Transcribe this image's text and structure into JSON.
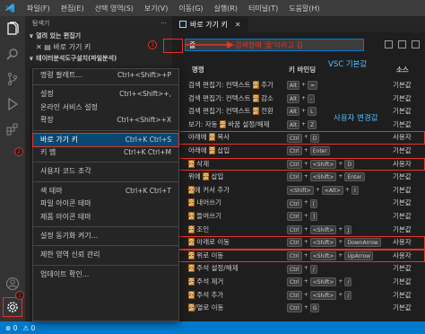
{
  "menubar": {
    "items": [
      "파일(F)",
      "편집(E)",
      "선택 영역(S)",
      "보기(V)",
      "이동(G)",
      "실행(R)",
      "터미널(T)",
      "도움말(H)"
    ]
  },
  "sidebar": {
    "title": "탐색기",
    "section_open": "열려 있는 편집기",
    "open_item": "바로 가기 키",
    "section_other": "테이터분석도구설치(파일분석)"
  },
  "context_menu": {
    "items": [
      {
        "label": "명령 팔레트...",
        "key": "Ctrl+<Shift>+P"
      },
      {
        "sep": true
      },
      {
        "label": "설정",
        "key": "Ctrl+<Shift>+,"
      },
      {
        "label": "온라인 서비스 설정",
        "key": ""
      },
      {
        "label": "확장",
        "key": "Ctrl+<Shift>+X"
      },
      {
        "sep": true
      },
      {
        "label": "바로 가기 키",
        "key": "Ctrl+K Ctrl+S",
        "active": true
      },
      {
        "label": "키 맵",
        "key": "Ctrl+K Ctrl+M"
      },
      {
        "sep": true
      },
      {
        "label": "사용자 코드 조각",
        "key": ""
      },
      {
        "sep": true
      },
      {
        "label": "색 테마",
        "key": "Ctrl+K Ctrl+T"
      },
      {
        "label": "파일 아이콘 테마",
        "key": ""
      },
      {
        "label": "제품 아이콘 테마",
        "key": ""
      },
      {
        "sep": true
      },
      {
        "label": "설정 동기화 켜기...",
        "key": ""
      },
      {
        "sep": true
      },
      {
        "label": "제한 영역 신뢰 관리",
        "key": ""
      },
      {
        "sep": true
      },
      {
        "label": "업데이트 확인...",
        "key": ""
      }
    ]
  },
  "tab": {
    "label": "바로 가기 키"
  },
  "search": {
    "value": "줄",
    "annotation": "검색창에 '줄'이라고 검"
  },
  "steps": {
    "one": "1",
    "two": "2",
    "three": "3"
  },
  "table": {
    "headers": {
      "command": "명령",
      "keybinding": "키 바인딩",
      "source": "소스"
    },
    "rows": [
      {
        "cmd": [
          "검색 편집기: 컨텍스트 ",
          "줄",
          " 추가"
        ],
        "keys": [
          "Alt",
          "+",
          "="
        ],
        "src": "기본값",
        "hl": false
      },
      {
        "cmd": [
          "검색 편집기: 컨텍스트 ",
          "줄",
          " 감소"
        ],
        "keys": [
          "Alt",
          "+",
          "-"
        ],
        "src": "기본값",
        "hl": false
      },
      {
        "cmd": [
          "검색 편집기: 컨텍스트 ",
          "줄",
          " 전환"
        ],
        "keys": [
          "Alt",
          "+",
          "L"
        ],
        "src": "기본값",
        "hl": false
      },
      {
        "cmd": [
          "보기: 자동 ",
          "줄",
          " 바꿈 설정/해제"
        ],
        "keys": [
          "Alt",
          "+",
          "Z"
        ],
        "src": "기본값",
        "hl": false
      },
      {
        "cmd": [
          "아래에 ",
          "줄",
          " 복사"
        ],
        "keys": [
          "Ctrl",
          "+",
          "D"
        ],
        "src": "사용자",
        "hl": true
      },
      {
        "cmd": [
          "아래에 ",
          "줄",
          " 삽입"
        ],
        "keys": [
          "Ctrl",
          "+",
          "Enter"
        ],
        "src": "기본값",
        "hl": false
      },
      {
        "cmd": [
          "",
          "줄",
          " 삭제"
        ],
        "keys": [
          "Ctrl",
          "+",
          "<Shift>",
          "+",
          "D"
        ],
        "src": "사용자",
        "hl": true
      },
      {
        "cmd": [
          "위에 ",
          "줄",
          " 삽입"
        ],
        "keys": [
          "Ctrl",
          "+",
          "<Shift>",
          "+",
          "Enter"
        ],
        "src": "기본값",
        "hl": false
      },
      {
        "cmd": [
          "",
          "줄",
          "에 커서 추가"
        ],
        "keys": [
          "<Shift>",
          "+",
          "<Alt>",
          "+",
          "I"
        ],
        "src": "기본값",
        "hl": false
      },
      {
        "cmd": [
          "",
          "줄",
          " 내어쓰기"
        ],
        "keys": [
          "Ctrl",
          "+",
          "["
        ],
        "src": "기본값",
        "hl": false
      },
      {
        "cmd": [
          "",
          "줄",
          " 들여쓰기"
        ],
        "keys": [
          "Ctrl",
          "+",
          "]"
        ],
        "src": "기본값",
        "hl": false
      },
      {
        "cmd": [
          "",
          "줄",
          " 조인"
        ],
        "keys": [
          "Ctrl",
          "+",
          "<Shift>",
          "+",
          "J"
        ],
        "src": "기본값",
        "hl": false
      },
      {
        "cmd": [
          "",
          "줄",
          " 아래로 이동"
        ],
        "keys": [
          "Ctrl",
          "+",
          "<Shift>",
          "+",
          "DownArrow"
        ],
        "src": "사용자",
        "hl": true
      },
      {
        "cmd": [
          "",
          "줄",
          " 위로 이동"
        ],
        "keys": [
          "Ctrl",
          "+",
          "<Shift>",
          "+",
          "UpArrow"
        ],
        "src": "사용자",
        "hl": true
      },
      {
        "cmd": [
          "",
          "줄",
          " 주석 설정/해제"
        ],
        "keys": [
          "Ctrl",
          "+",
          "/"
        ],
        "src": "기본값",
        "hl": false
      },
      {
        "cmd": [
          "",
          "줄",
          " 주석 제거"
        ],
        "keys": [
          "Ctrl",
          "+",
          "<Shift>",
          "+",
          "/"
        ],
        "src": "기본값",
        "hl": false
      },
      {
        "cmd": [
          "",
          "줄",
          " 주석 추가"
        ],
        "keys": [
          "Ctrl",
          "+",
          "<Shift>",
          "+",
          "/"
        ],
        "src": "기본값",
        "hl": false
      },
      {
        "cmd": [
          "",
          "줄",
          "/열로 이동"
        ],
        "keys": [
          "Ctrl",
          "+",
          "G"
        ],
        "src": "기본값",
        "hl": false
      }
    ]
  },
  "annotations": {
    "vsc_default": "VSC 기본값",
    "user_changed": "사용자 변경값"
  },
  "status": {
    "errors": "⊗ 0",
    "warnings": "⚠ 0"
  },
  "colors": {
    "accent": "#007acc",
    "annotation_red": "#e5332a",
    "annotation_blue": "#4fc1ff"
  }
}
